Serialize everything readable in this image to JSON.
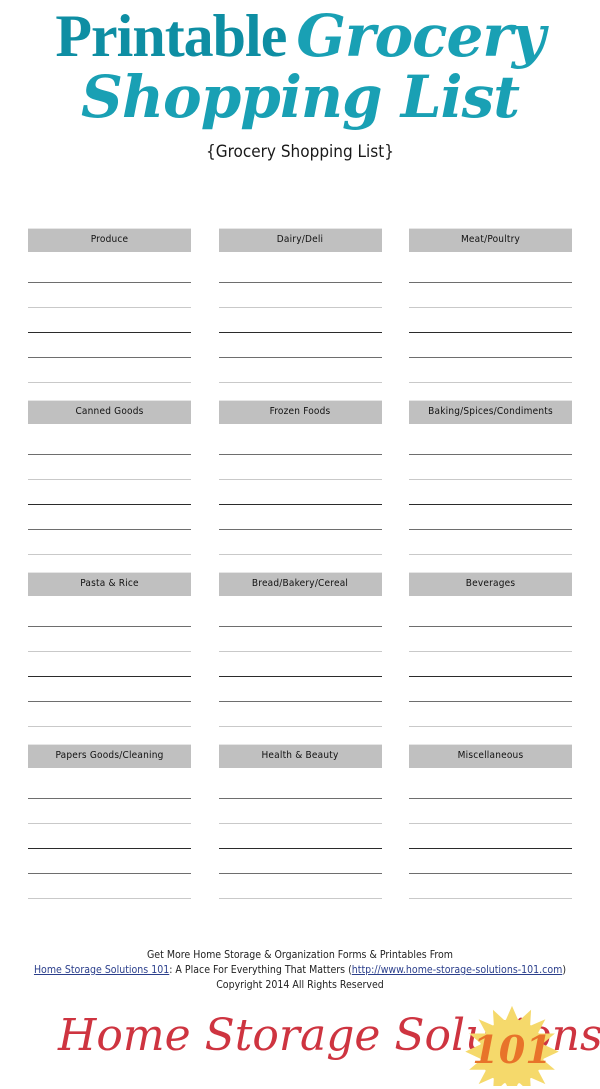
{
  "title": {
    "word_1": "Printable",
    "word_2": "Grocery",
    "line_2": "Shopping List",
    "subtitle": "{Grocery Shopping List}",
    "accent_color": "#0E8EA3",
    "script_color": "#19A0B4"
  },
  "categories": [
    {
      "label": "Produce",
      "lines": 5
    },
    {
      "label": "Dairy/Deli",
      "lines": 5
    },
    {
      "label": "Meat/Poultry",
      "lines": 5
    },
    {
      "label": "Canned Goods",
      "lines": 5
    },
    {
      "label": "Frozen Foods",
      "lines": 5
    },
    {
      "label": "Baking/Spices/Condiments",
      "lines": 5
    },
    {
      "label": "Pasta & Rice",
      "lines": 5
    },
    {
      "label": "Bread/Bakery/Cereal",
      "lines": 5
    },
    {
      "label": "Beverages",
      "lines": 5
    },
    {
      "label": "Papers Goods/Cleaning",
      "lines": 5
    },
    {
      "label": "Health & Beauty",
      "lines": 5
    },
    {
      "label": "Miscellaneous",
      "lines": 5
    }
  ],
  "header_bg_color": "#c0c0c0",
  "footer": {
    "line_1": "Get More Home Storage & Organization Forms & Printables From",
    "link_text": "Home Storage Solutions 101",
    "line_2_middle": ": A Place For Everything That Matters (",
    "url_text": "http://www.home-storage-solutions-101.com",
    "line_2_end": ")",
    "copyright": "Copyright 2014 All Rights Reserved",
    "link_color": "#2b3f8c"
  },
  "logo": {
    "text": "Home Storage Solutions",
    "badge_number": "101",
    "text_color": "#CE3440",
    "sun_color": "#F5D96B",
    "number_color": "#E8732A"
  }
}
